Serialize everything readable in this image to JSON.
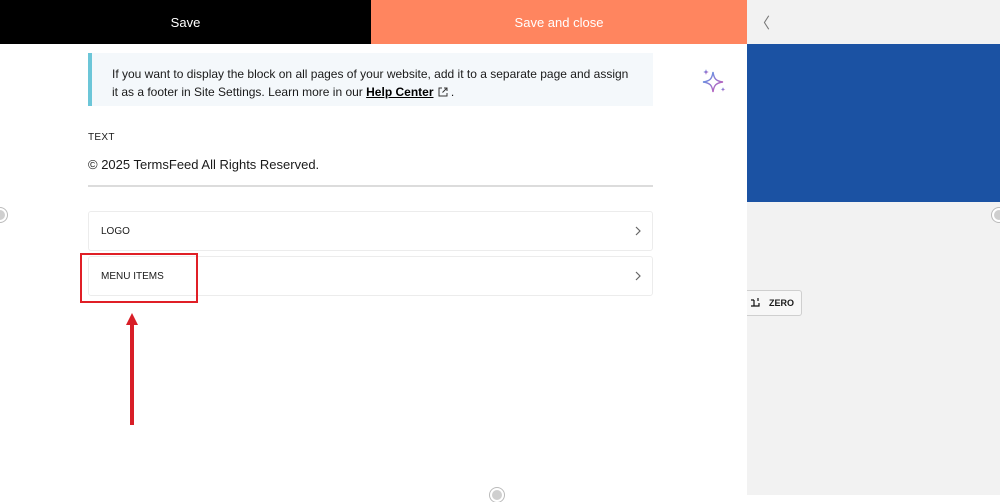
{
  "toolbar": {
    "save_label": "Save",
    "save_close_label": "Save and close"
  },
  "notice": {
    "text": "If you want to display the block on all pages of your website, add it to a separate page and assign it as a footer in Site Settings. Learn more in our ",
    "link_label": "Help Center",
    "trailing": " ."
  },
  "text_field": {
    "label": "TEXT",
    "value": "© 2025 TermsFeed All Rights Reserved."
  },
  "sections": [
    {
      "label": "LOGO"
    },
    {
      "label": "MENU ITEMS"
    }
  ],
  "preview": {
    "zero_label": "ZERO",
    "collapse_glyph": "〈"
  },
  "colors": {
    "save_bg": "#000000",
    "save_close_bg": "#ff855f",
    "preview_block": "#1b52a3",
    "highlight": "#e01f26",
    "notice_border": "#6cc6d8"
  },
  "icons": [
    "external-link-icon",
    "sparkle-icon",
    "chevron-right-icon",
    "zero-icon",
    "red-up-arrow"
  ]
}
